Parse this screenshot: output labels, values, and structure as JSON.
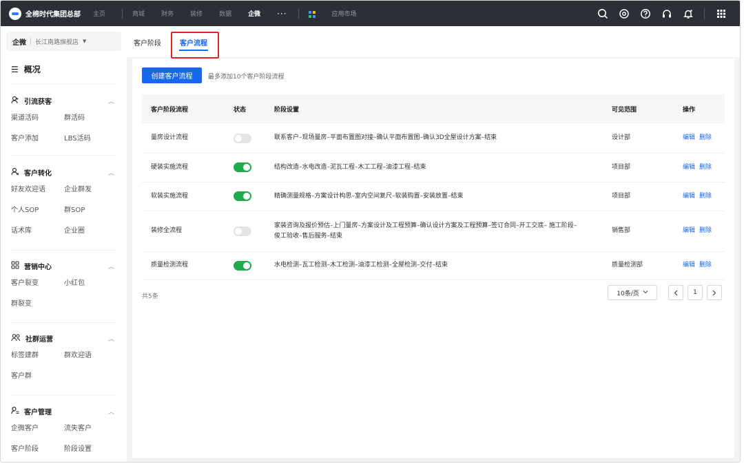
{
  "app": {
    "brand": "全棉时代集团总部"
  },
  "nav": {
    "items": [
      "主页",
      "商城",
      "财务",
      "装修",
      "数据",
      "企微"
    ],
    "active": "企微",
    "more": "···",
    "market": "应用市场"
  },
  "toolbar_icons": [
    "search-icon",
    "settings-icon",
    "help-icon",
    "headset-icon",
    "bell-icon",
    "grid-menu-icon"
  ],
  "sidebar": {
    "org": "企微",
    "store": "长江南路旗舰店",
    "overview": "概况",
    "groups": [
      {
        "title": "引流获客",
        "icon": "user-plus-icon",
        "items": [
          "渠道活码",
          "群活码",
          "客户添加",
          "LBS活码"
        ]
      },
      {
        "title": "客户转化",
        "icon": "user-convert-icon",
        "items": [
          "好友欢迎语",
          "企业群发",
          "个人SOP",
          "群SOP",
          "话术库",
          "企业圈"
        ]
      },
      {
        "title": "营销中心",
        "icon": "apps-icon",
        "items": [
          "客户裂变",
          "小红包",
          "群裂变"
        ]
      },
      {
        "title": "社群运营",
        "icon": "group-icon",
        "items": [
          "标签建群",
          "群欢迎语",
          "客户群"
        ]
      },
      {
        "title": "客户管理",
        "icon": "user-list-icon",
        "items": [
          "企微客户",
          "流失客户",
          "客户阶段",
          "阶段设置"
        ]
      }
    ]
  },
  "tabs": [
    {
      "label": "客户阶段"
    },
    {
      "label": "客户流程"
    }
  ],
  "active_tab": "客户流程",
  "main": {
    "create_button": "创建客户流程",
    "hint": "最多添加10个客户阶段流程",
    "columns": [
      "客户阶段流程",
      "状态",
      "阶段设置",
      "可见范围",
      "操作"
    ],
    "rows": [
      {
        "name": "量房设计流程",
        "enabled": false,
        "stages": "联系客户–现场量房–平面布置图对接–确认平面布置图–确认3D全屋设计方案–结束",
        "scope": "设计部"
      },
      {
        "name": "硬装实施流程",
        "enabled": true,
        "stages": "结构改造–水电改造–泥瓦工程–木工工程–油漆工程–结束",
        "scope": "项目部"
      },
      {
        "name": "软装实施流程",
        "enabled": true,
        "stages": "精确测量规格–方案设计构思–室内空间复尺–软装购置–安装放置–结束",
        "scope": "项目部"
      },
      {
        "name": "装修全流程",
        "enabled": false,
        "stages": "家装咨询及报价预估–上门量房–方案设计及工程预算–确认设计方案及工程预算–签订合同–开工交底– 施工阶段–俊工验收–售后服务–结束",
        "scope": "销售部"
      },
      {
        "name": "质量检测流程",
        "enabled": true,
        "stages": "水电检测–瓦工检测–木工检测–油漆工检测–全屋检测–交付–结束",
        "scope": "质量检测部"
      }
    ],
    "edit_label": "编辑",
    "delete_label": "删除",
    "total": "共5条",
    "page_size": "10条/页",
    "current_page": "1"
  }
}
